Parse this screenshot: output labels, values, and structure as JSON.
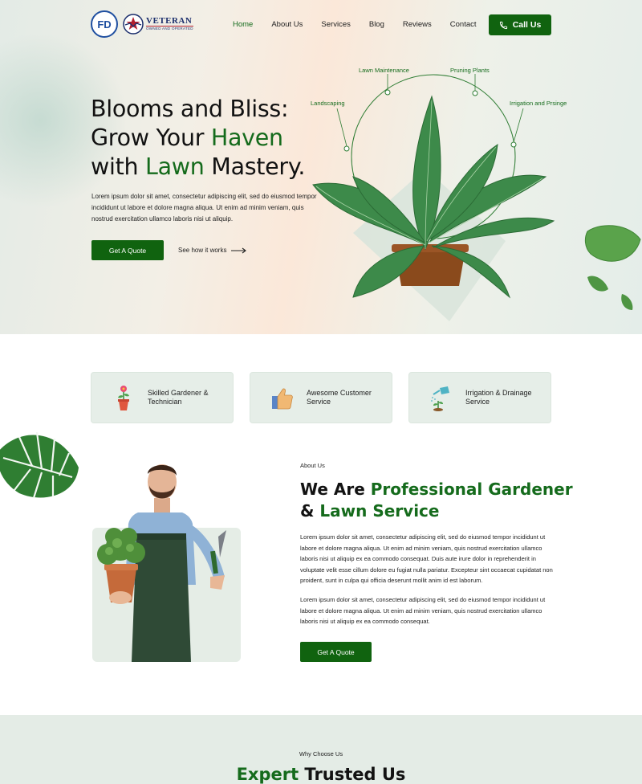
{
  "brand": {
    "logo_initials": "FD",
    "veteran_word": "VETERAN",
    "veteran_sub": "OWNED AND OPERATED"
  },
  "nav": {
    "items": [
      {
        "label": "Home",
        "active": true
      },
      {
        "label": "About Us",
        "active": false
      },
      {
        "label": "Services",
        "active": false
      },
      {
        "label": "Blog",
        "active": false
      },
      {
        "label": "Reviews",
        "active": false
      },
      {
        "label": "Contact",
        "active": false
      }
    ],
    "call_label": "Call Us"
  },
  "hero": {
    "title_line1": "Blooms and Bliss:",
    "title_line2_a": "Grow Your ",
    "title_line2_b": "Haven",
    "title_line3_a": "with ",
    "title_line3_b": "Lawn",
    "title_line3_c": " Mastery.",
    "text": "Lorem ipsum dolor sit amet, consectetur adipiscing elit, sed do eiusmod tempor incididunt ut labore et dolore magna aliqua. Ut enim ad minim veniam, quis nostrud exercitation ullamco laboris nisi ut aliquip.",
    "quote_label": "Get A Quote",
    "see_how_label": "See how it works",
    "service_labels": {
      "landscaping": "Landscaping",
      "lawn_maintenance": "Lawn Maintenance",
      "pruning": "Pruning Plants",
      "irrigation": "Irrigation and Prsinge"
    }
  },
  "features": [
    {
      "label": "Skilled Gardener & Technician",
      "icon": "flower-pot-icon"
    },
    {
      "label": "Awesome Customer Service",
      "icon": "thumbs-up-icon"
    },
    {
      "label": "Irrigation & Drainage Service",
      "icon": "watering-can-icon"
    }
  ],
  "about": {
    "kicker": "About Us",
    "title_a": "We Are ",
    "title_b": "Professional Gardener",
    "title_c": "& ",
    "title_d": "Lawn Service",
    "p1": "Lorem ipsum dolor sit amet, consectetur adipiscing elit, sed do eiusmod tempor incididunt ut labore et dolore magna aliqua. Ut enim ad minim veniam, quis nostrud exercitation ullamco laboris nisi ut aliquip ex ea commodo consequat. Duis aute irure dolor in reprehenderit in voluptate velit esse cillum dolore eu fugiat nulla pariatur. Excepteur sint occaecat cupidatat non proident, sunt in culpa qui officia deserunt mollit anim id est laborum.",
    "p2": "Lorem ipsum dolor sit amet, consectetur adipiscing elit, sed do eiusmod tempor incididunt ut labore et dolore magna aliqua. Ut enim ad minim veniam, quis nostrud exercitation ullamco laboris nisi ut aliquip ex ea commodo consequat.",
    "quote_label": "Get A Quote"
  },
  "why": {
    "kicker": "Why Choose Us",
    "title_a": "Expert",
    "title_b": " Trusted Us"
  },
  "colors": {
    "accent": "#10630f",
    "accent_text": "#156b1c",
    "card_bg": "#e6eee8"
  }
}
